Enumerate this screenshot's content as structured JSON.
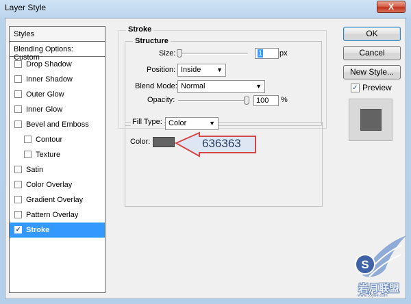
{
  "window": {
    "title": "Layer Style",
    "close_label": "X"
  },
  "styles_panel": {
    "header": "Styles",
    "blending_options": "Blending Options: Custom",
    "items": [
      {
        "label": "Drop Shadow",
        "checked": false,
        "sub": false
      },
      {
        "label": "Inner Shadow",
        "checked": false,
        "sub": false
      },
      {
        "label": "Outer Glow",
        "checked": false,
        "sub": false
      },
      {
        "label": "Inner Glow",
        "checked": false,
        "sub": false
      },
      {
        "label": "Bevel and Emboss",
        "checked": false,
        "sub": false
      },
      {
        "label": "Contour",
        "checked": false,
        "sub": true
      },
      {
        "label": "Texture",
        "checked": false,
        "sub": true
      },
      {
        "label": "Satin",
        "checked": false,
        "sub": false
      },
      {
        "label": "Color Overlay",
        "checked": false,
        "sub": false
      },
      {
        "label": "Gradient Overlay",
        "checked": false,
        "sub": false
      },
      {
        "label": "Pattern Overlay",
        "checked": false,
        "sub": false
      },
      {
        "label": "Stroke",
        "checked": true,
        "sub": false,
        "selected": true
      }
    ]
  },
  "stroke": {
    "group_title": "Stroke",
    "structure_title": "Structure",
    "size_label": "Size:",
    "size_value": "1",
    "size_unit": "px",
    "size_slider_fraction": 0.0,
    "position_label": "Position:",
    "position_value": "Inside",
    "blend_mode_label": "Blend Mode:",
    "blend_mode_value": "Normal",
    "opacity_label": "Opacity:",
    "opacity_value": "100",
    "opacity_unit": "%",
    "opacity_slider_fraction": 1.0,
    "fill_type_label": "Fill Type:",
    "fill_type_value": "Color",
    "color_label": "Color:",
    "color_value": "#636363"
  },
  "callout": {
    "text": "636363"
  },
  "buttons": {
    "ok": "OK",
    "cancel": "Cancel",
    "new_style": "New Style...",
    "preview_label": "Preview",
    "preview_checked": true
  },
  "watermark": {
    "brand": "岩月联盟",
    "url": "www.55yue.com",
    "logo_letter": "S"
  }
}
